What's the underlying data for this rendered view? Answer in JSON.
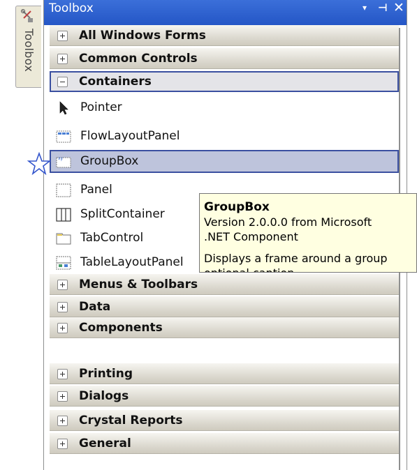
{
  "side_tab": {
    "label": "Toolbox",
    "icon": "toolbox-icon"
  },
  "window": {
    "title": "Toolbox",
    "controls": {
      "dropdown": "▾",
      "pin": "⊣",
      "close": "✕"
    }
  },
  "categories_top": [
    {
      "label": "All Windows Forms",
      "expanded": false
    },
    {
      "label": "Common Controls",
      "expanded": false
    },
    {
      "label": "Containers",
      "expanded": true
    }
  ],
  "container_items": [
    {
      "label": "Pointer",
      "icon": "pointer-arrow-icon"
    },
    {
      "label": "FlowLayoutPanel",
      "icon": "flowlayoutpanel-icon"
    },
    {
      "label": "GroupBox",
      "icon": "groupbox-icon",
      "selected": true
    },
    {
      "label": "Panel",
      "icon": "panel-icon"
    },
    {
      "label": "SplitContainer",
      "icon": "splitcontainer-icon"
    },
    {
      "label": "TabControl",
      "icon": "tabcontrol-icon"
    },
    {
      "label": "TableLayoutPanel",
      "icon": "tablelayoutpanel-icon"
    }
  ],
  "categories_bottom": [
    {
      "label": "Menus & Toolbars",
      "expanded": false
    },
    {
      "label": "Data",
      "expanded": false
    },
    {
      "label": "Components",
      "expanded": false
    },
    {
      "label": "Printing",
      "expanded": false
    },
    {
      "label": "Dialogs",
      "expanded": false
    },
    {
      "label": "Crystal Reports",
      "expanded": false
    },
    {
      "label": "General",
      "expanded": false
    }
  ],
  "tooltip": {
    "title": "GroupBox",
    "version": "Version 2.0.0.0 from Microsoft",
    "component": ".NET Component",
    "description_1": "Displays a frame around a group",
    "description_2": "optional caption."
  },
  "marker": {
    "icon": "star-icon",
    "color": "#3355cc"
  },
  "colors": {
    "title_bar": "#2456c6",
    "selection": "#bec4dc",
    "selection_border": "#3a4fa0",
    "tooltip_bg": "#ffffe1"
  }
}
